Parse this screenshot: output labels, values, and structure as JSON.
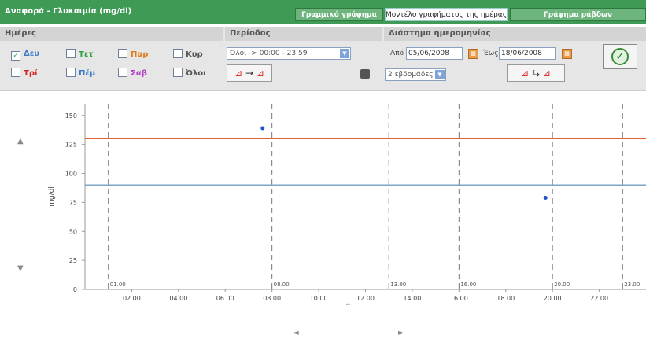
{
  "header": {
    "title": "Αναφορά - Γλυκαιμία (mg/dl)",
    "tabs": [
      {
        "label": "Γραμμικό γράφημα",
        "active": false
      },
      {
        "label": "Μοντέλο γραφήματος της ημέρας",
        "active": true
      },
      {
        "label": "Γράφημα ράβδων",
        "active": false
      }
    ]
  },
  "filters": {
    "days_heading": "Ημέρες",
    "days": [
      {
        "label": "Δευ",
        "checked": true,
        "color": "#3a78c9"
      },
      {
        "label": "Τετ",
        "checked": false,
        "color": "#2e9e3e"
      },
      {
        "label": "Παρ",
        "checked": false,
        "color": "#e07b1a"
      },
      {
        "label": "Κυρ",
        "checked": false,
        "color": "#555555"
      },
      {
        "label": "Τρί",
        "checked": false,
        "color": "#d32222"
      },
      {
        "label": "Πέμ",
        "checked": false,
        "color": "#3a78c9"
      },
      {
        "label": "Σαβ",
        "checked": false,
        "color": "#b23ac9"
      },
      {
        "label": "Όλοι",
        "checked": false,
        "color": "#555555"
      }
    ],
    "check_mark": "✓",
    "period_heading": "Περίοδος",
    "period_value": "Όλοι -> 00:00 - 23:59",
    "dates_heading": "Διάστημα ημερομηνίας",
    "from_label": "Από",
    "from_date": "05/06/2008",
    "to_label": "Έως",
    "to_date": "18/06/2008",
    "range_value": "2 εβδομάδες",
    "ok_symbol": "✓"
  },
  "chart_data": {
    "type": "scatter",
    "ylabel": "mg/dl",
    "xlabel": "Ώρα",
    "ylim": [
      0,
      160
    ],
    "yticks": [
      0,
      25,
      50,
      75,
      100,
      125,
      150
    ],
    "xlim": [
      0,
      24
    ],
    "xticks": [
      "02.00",
      "04.00",
      "06.00",
      "08.00",
      "10.00",
      "12.00",
      "14.00",
      "16.00",
      "18.00",
      "20.00",
      "22.00"
    ],
    "xtick_values": [
      2,
      4,
      6,
      8,
      10,
      12,
      14,
      16,
      18,
      20,
      22
    ],
    "upper_limit": 130,
    "lower_limit": 90,
    "upper_color": "#e0603a",
    "lower_color": "#7aa6c8",
    "point_color": "#2255cc",
    "dividers": [
      {
        "x": 1,
        "label": "01.00"
      },
      {
        "x": 8,
        "label": "08.00"
      },
      {
        "x": 13,
        "label": "13.00"
      },
      {
        "x": 16,
        "label": "16.00"
      },
      {
        "x": 20,
        "label": "20.00"
      },
      {
        "x": 23,
        "label": "23.00"
      }
    ],
    "points": [
      {
        "x": 7.6,
        "y": 139
      },
      {
        "x": 19.7,
        "y": 79
      }
    ]
  },
  "nav": {
    "up": "▲",
    "down": "▼",
    "left": "◄",
    "right": "►"
  }
}
